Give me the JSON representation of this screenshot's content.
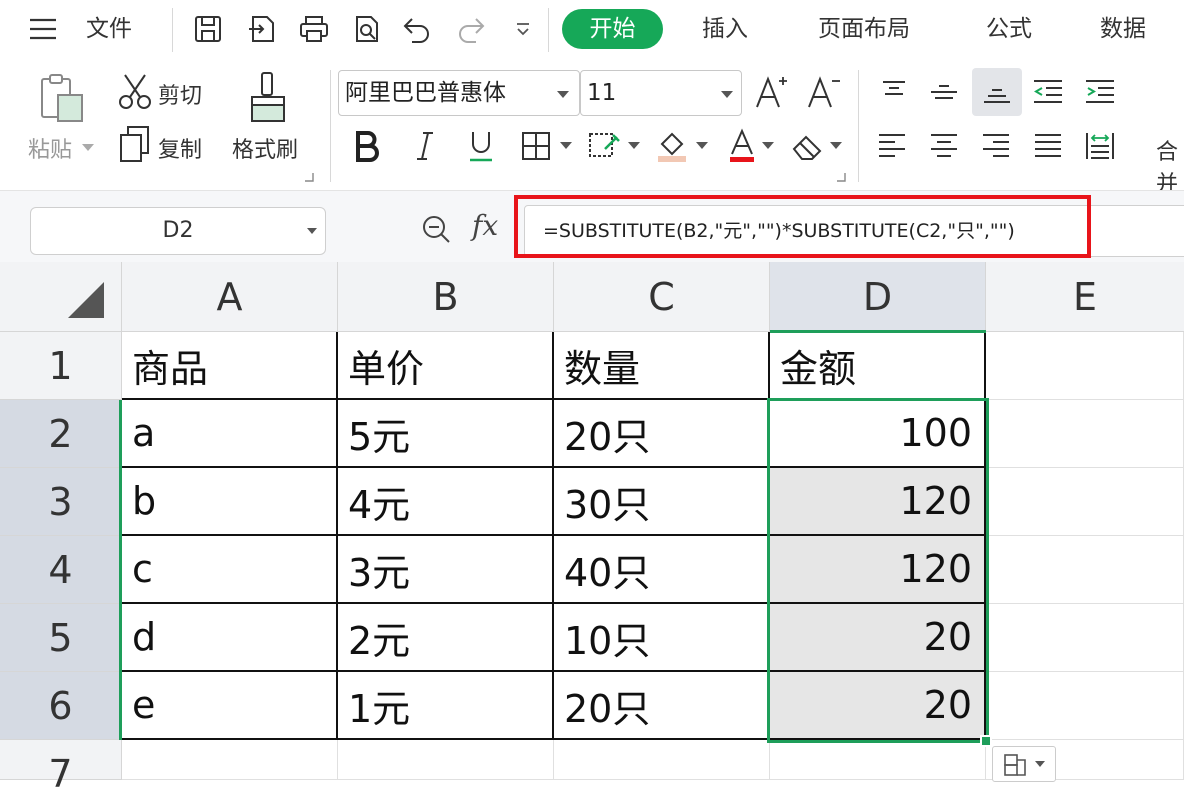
{
  "menu": {
    "file_label": "文件",
    "tabs": [
      "开始",
      "插入",
      "页面布局",
      "公式",
      "数据"
    ]
  },
  "ribbon": {
    "paste_label": "粘贴",
    "cut_label": "剪切",
    "copy_label": "复制",
    "format_painter_label": "格式刷",
    "font_name": "阿里巴巴普惠体",
    "font_size": "11",
    "merge_label": "合并"
  },
  "formula_bar": {
    "name_box": "D2",
    "fx_label": "fx",
    "formula": "=SUBSTITUTE(B2,\"元\",\"\")*SUBSTITUTE(C2,\"只\",\"\")"
  },
  "sheet": {
    "columns": [
      "A",
      "B",
      "C",
      "D",
      "E"
    ],
    "row_numbers": [
      "1",
      "2",
      "3",
      "4",
      "5",
      "6",
      "7"
    ],
    "header_row": [
      "商品",
      "单价",
      "数量",
      "金额"
    ],
    "rows": [
      [
        "a",
        "5元",
        "20只",
        "100"
      ],
      [
        "b",
        "4元",
        "30只",
        "120"
      ],
      [
        "c",
        "3元",
        "40只",
        "120"
      ],
      [
        "d",
        "2元",
        "10只",
        "20"
      ],
      [
        "e",
        "1元",
        "20只",
        "20"
      ]
    ]
  },
  "colors": {
    "accent_green": "#16a858",
    "selection_green": "#1e9e5a",
    "highlight_red": "#e8141a"
  }
}
